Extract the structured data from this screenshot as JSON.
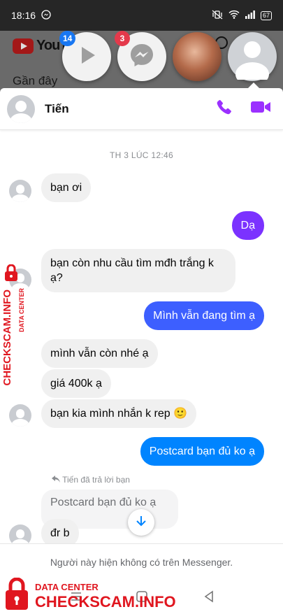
{
  "status_bar": {
    "time": "18:16",
    "battery": "67"
  },
  "background_app": {
    "logo_text": "YouTube",
    "section_label": "Gần đây"
  },
  "chat_heads": [
    {
      "name": "video-head",
      "badge": "14",
      "badge_color": "#1877f2"
    },
    {
      "name": "messenger-head",
      "badge": "3",
      "badge_color": "#e4394b"
    },
    {
      "name": "photo-head",
      "badge": ""
    },
    {
      "name": "active-contact-head",
      "badge": ""
    }
  ],
  "chat": {
    "contact_name": "Tiến",
    "timestamp": "TH 3 LÚC 12:46",
    "messages": [
      {
        "dir": "in",
        "text": "bạn ơi"
      },
      {
        "dir": "out",
        "text": "Dạ"
      },
      {
        "dir": "in",
        "text": "bạn còn nhu cầu tìm mđh trắng k ạ?"
      },
      {
        "dir": "out",
        "text": "Mình vẫn đang tìm ạ"
      },
      {
        "dir": "in",
        "text": "mình vẫn còn nhé ạ"
      },
      {
        "dir": "in",
        "text": "giá 400k ạ"
      },
      {
        "dir": "in",
        "text": "bạn kia mình nhắn k rep 🙂"
      },
      {
        "dir": "out",
        "text": "Postcard bạn đủ ko ạ"
      },
      {
        "dir": "in",
        "text": "đr b"
      }
    ],
    "reply_label": "Tiến đã trả lời bạn",
    "quoted_text": "Postcard bạn đủ ko ạ",
    "footer_text": "Người này hiện không có trên Messenger."
  },
  "watermark": {
    "label_top": "DATA CENTER",
    "label_main": "CHECKSCAM.INFO"
  },
  "colors": {
    "accent_purple": "#7b32ff",
    "accent_blue": "#3d5fff",
    "messenger_icon": "#9b30ff"
  }
}
